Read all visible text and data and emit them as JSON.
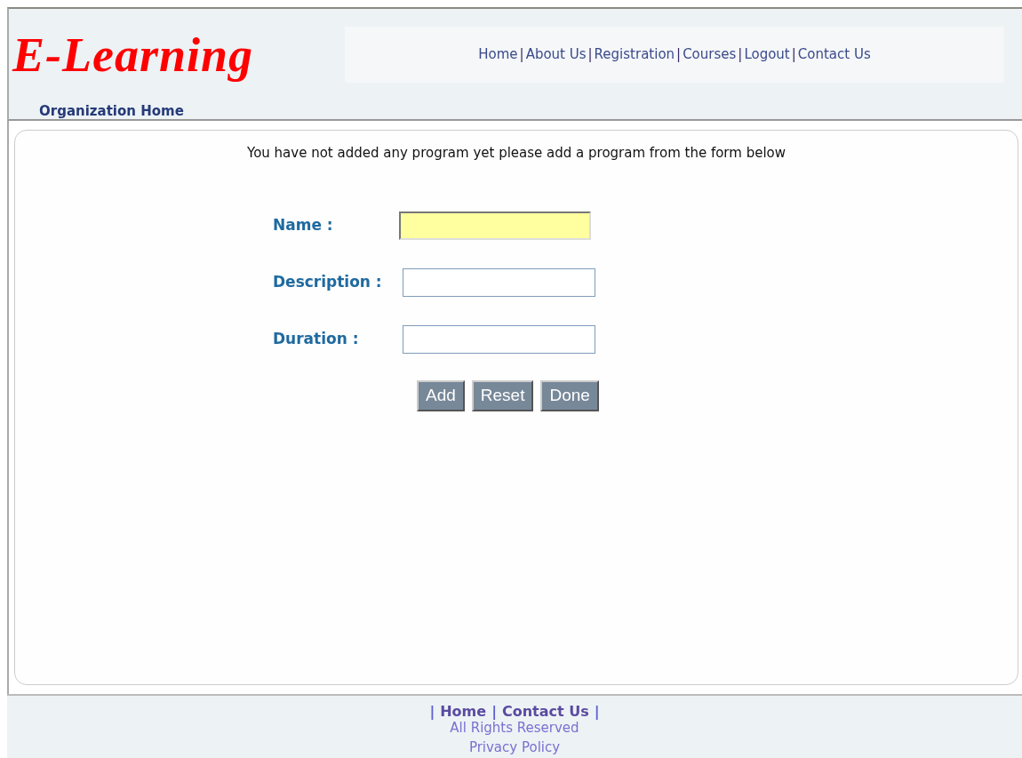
{
  "logo": {
    "text": "E-Learning"
  },
  "nav": [
    {
      "kind": "link",
      "text": "Home"
    },
    {
      "kind": "sep",
      "text": "|"
    },
    {
      "kind": "link",
      "text": "About Us"
    },
    {
      "kind": "sep",
      "text": "|"
    },
    {
      "kind": "link",
      "text": "Registration"
    },
    {
      "kind": "sep",
      "text": "|"
    },
    {
      "kind": "link",
      "text": "Courses"
    },
    {
      "kind": "sep",
      "text": "|"
    },
    {
      "kind": "link",
      "text": "Logout"
    },
    {
      "kind": "sep",
      "text": "|"
    },
    {
      "kind": "link",
      "text": "Contact Us"
    }
  ],
  "breadcrumb": "Organization Home",
  "message": "You have not added any program yet please add a program from the form below",
  "form": {
    "fields": [
      {
        "label": "Name :",
        "focused": true
      },
      {
        "label": "Description :",
        "focused": false
      },
      {
        "label": "Duration :",
        "focused": false
      }
    ],
    "buttons": [
      "Add",
      "Reset",
      "Done"
    ]
  },
  "footer": {
    "links": [
      {
        "kind": "sep",
        "text": "|"
      },
      {
        "kind": "link",
        "text": "Home"
      },
      {
        "kind": "sep",
        "text": "|"
      },
      {
        "kind": "link",
        "text": "Contact Us"
      },
      {
        "kind": "sep",
        "text": "|"
      }
    ],
    "rights": "All Rights Reserved",
    "privacy": "Privacy Policy"
  }
}
